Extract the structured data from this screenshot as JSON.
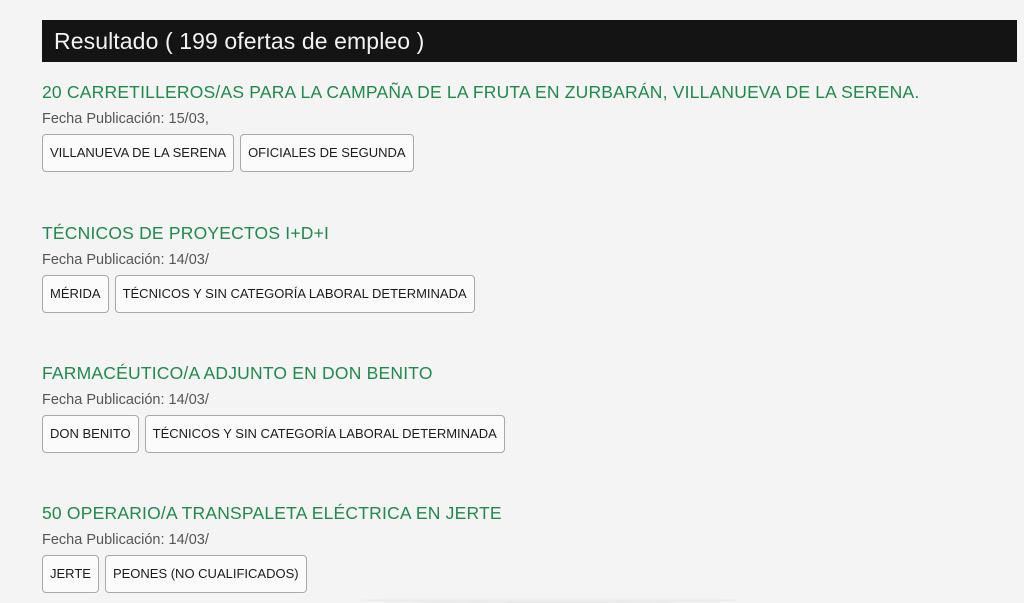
{
  "header": {
    "result_text": "Resultado ( 199 ofertas de empleo )"
  },
  "offers": [
    {
      "title": "20 CARRETILLEROS/AS PARA LA CAMPAÑA DE LA FRUTA EN ZURBARÁN, VILLANUEVA DE LA SERENA.",
      "date": "Fecha Publicación: 15/03,",
      "tags": [
        "VILLANUEVA DE LA SERENA",
        "OFICIALES DE SEGUNDA"
      ]
    },
    {
      "title": "TÉCNICOS DE PROYECTOS I+D+I",
      "date": "Fecha Publicación: 14/03/",
      "tags": [
        "MÉRIDA",
        "TÉCNICOS Y SIN CATEGORÍA LABORAL DETERMINADA"
      ]
    },
    {
      "title": "FARMACÉUTICO/A ADJUNTO EN DON BENITO",
      "date": "Fecha Publicación: 14/03/",
      "tags": [
        "DON BENITO",
        "TÉCNICOS Y SIN CATEGORÍA LABORAL DETERMINADA"
      ]
    },
    {
      "title": "50 OPERARIO/A TRANSPALETA ELÉCTRICA EN JERTE",
      "date": "Fecha Publicación: 14/03/",
      "tags": [
        "JERTE",
        "PEONES (NO CUALIFICADOS)"
      ]
    }
  ]
}
